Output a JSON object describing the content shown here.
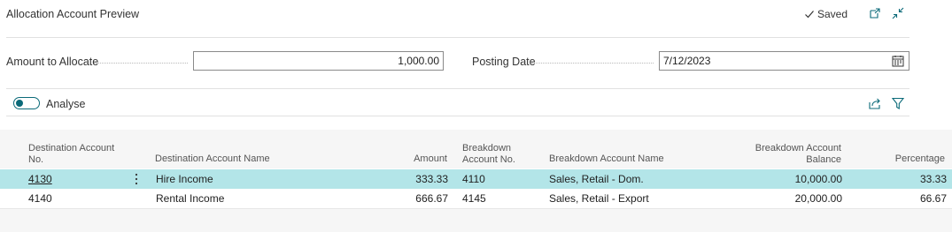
{
  "header": {
    "title": "Allocation Account Preview",
    "saved_label": "Saved"
  },
  "fields": {
    "amount_label": "Amount to Allocate",
    "amount_value": "1,000.00",
    "posting_date_label": "Posting Date",
    "posting_date_value": "7/12/2023"
  },
  "toolbar": {
    "analyse_label": "Analyse",
    "analyse_on": false
  },
  "table": {
    "headers": {
      "dest_account_no_1": "Destination Account",
      "dest_account_no_2": "No.",
      "dest_account_name": "Destination Account Name",
      "amount": "Amount",
      "breakdown_no_1": "Breakdown",
      "breakdown_no_2": "Account No.",
      "breakdown_name": "Breakdown Account Name",
      "breakdown_balance_1": "Breakdown Account",
      "breakdown_balance_2": "Balance",
      "percentage": "Percentage"
    },
    "rows": [
      {
        "dest_no": "4130",
        "dest_name": "Hire Income",
        "amount": "333.33",
        "breakdown_no": "4110",
        "breakdown_name": "Sales, Retail - Dom.",
        "balance": "10,000.00",
        "percentage": "33.33"
      },
      {
        "dest_no": "4140",
        "dest_name": "Rental Income",
        "amount": "666.67",
        "breakdown_no": "4145",
        "breakdown_name": "Sales, Retail - Export",
        "balance": "20,000.00",
        "percentage": "66.67"
      }
    ]
  },
  "colors": {
    "accent": "#0b6a79",
    "selected_row": "#b3e5e8"
  }
}
